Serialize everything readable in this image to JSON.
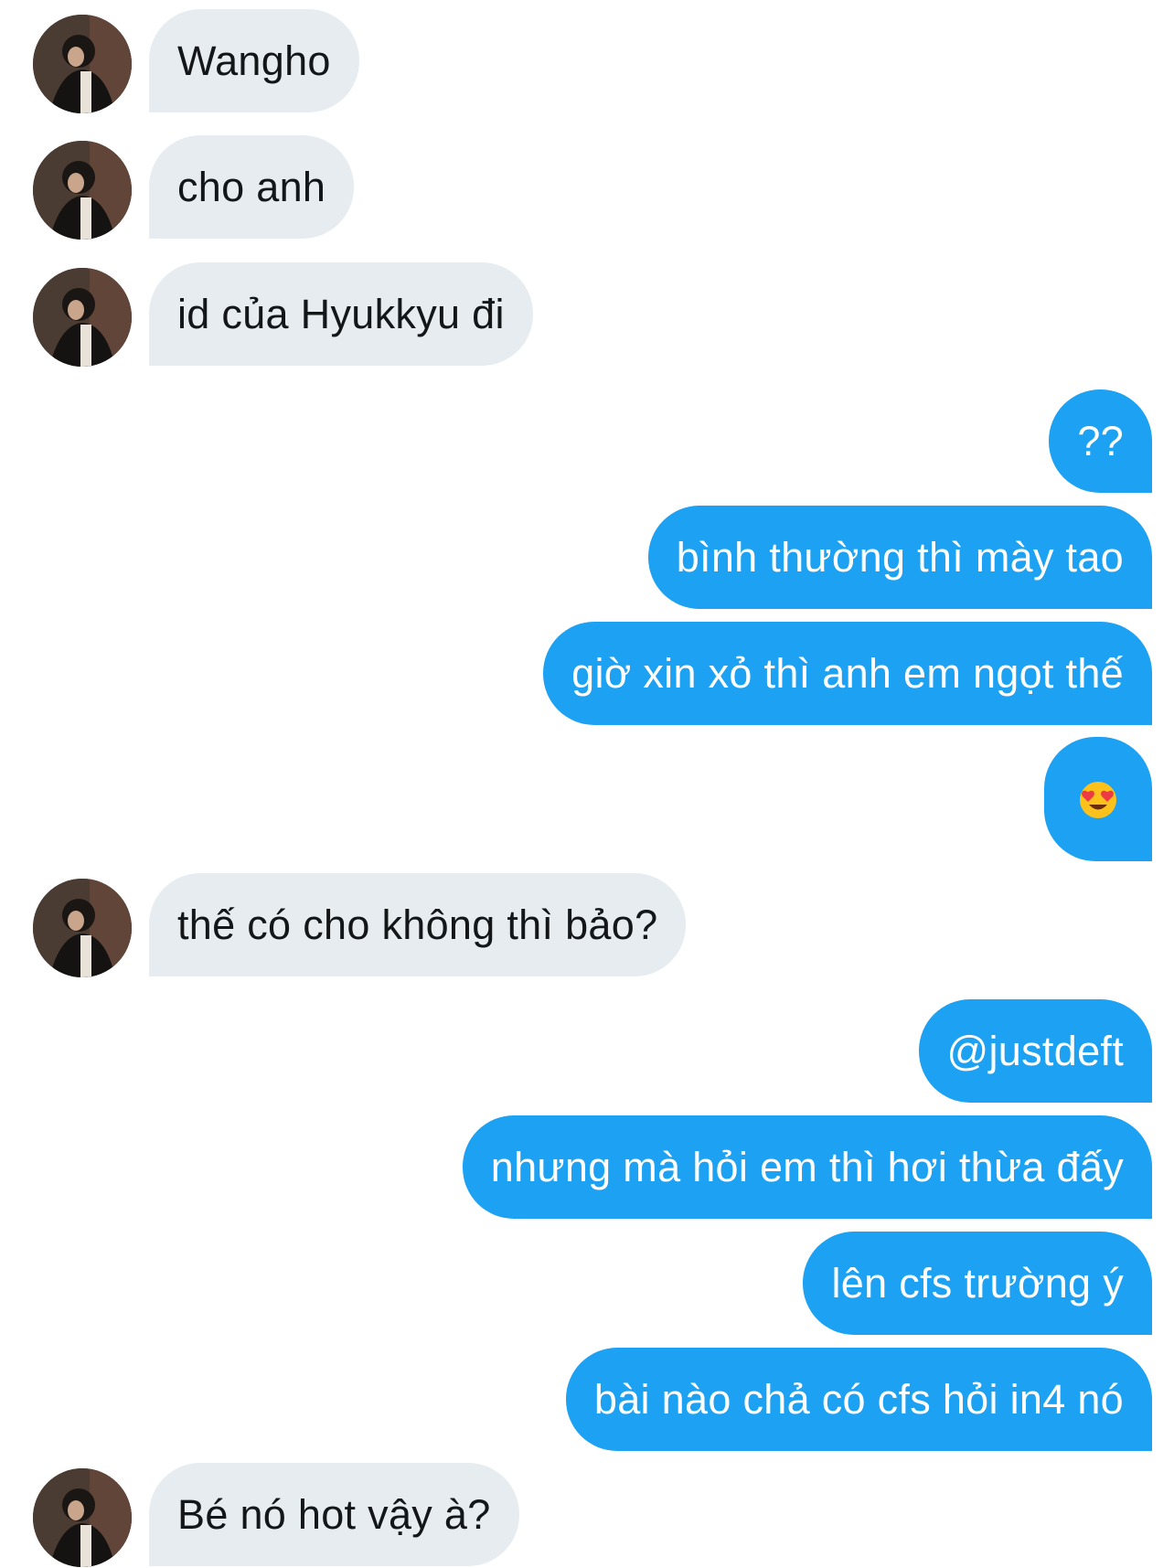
{
  "conversation": {
    "messages": [
      {
        "from": "them",
        "text": "Wangho"
      },
      {
        "from": "them",
        "text": "cho anh"
      },
      {
        "from": "them",
        "text": "id của Hyukkyu đi"
      },
      {
        "from": "me",
        "text": "??"
      },
      {
        "from": "me",
        "text": "bình thường thì mày tao"
      },
      {
        "from": "me",
        "text": "giờ xin xỏ thì anh em ngọt thế"
      },
      {
        "from": "me",
        "emoji": "heart-eyes-emoji"
      },
      {
        "from": "them",
        "text": "thế có cho không thì bảo?"
      },
      {
        "from": "me",
        "text": "@justdeft"
      },
      {
        "from": "me",
        "text": "nhưng mà hỏi em thì hơi thừa đấy"
      },
      {
        "from": "me",
        "text": "lên cfs trường ý"
      },
      {
        "from": "me",
        "text": "bài nào chả có cfs hỏi in4 nó"
      },
      {
        "from": "them",
        "text": "Bé nó hot vậy à?"
      }
    ]
  },
  "colors": {
    "incoming_bubble": "#e6ecf0",
    "incoming_text": "#14171a",
    "outgoing_bubble": "#1da1f2",
    "outgoing_text": "#ffffff"
  }
}
